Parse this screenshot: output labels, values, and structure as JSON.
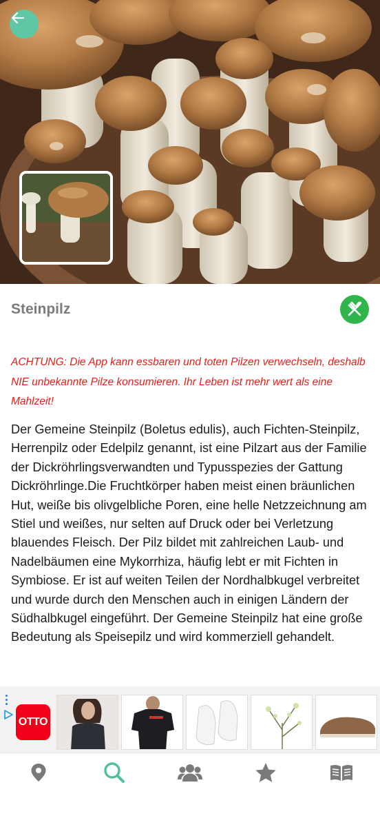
{
  "app": {
    "title": "Steinpilz"
  },
  "header": {
    "back_icon": "arrow-left-icon",
    "back_color": "#5fc7a3"
  },
  "mushroom": {
    "name": "Steinpilz",
    "edibility_icon": "fork-knife-icon",
    "edibility_color": "#2fb54a"
  },
  "warning": {
    "text": "ACHTUNG: Die App kann essbaren und toten Pilzen verwechseln, deshalb NIE unbekannte Pilze konsumieren. Ihr Leben ist mehr wert als eine Mahlzeit!",
    "color": "#e3211b"
  },
  "description": "Der Gemeine Steinpilz (Boletus edulis), auch Fichten-Steinpilz, Herrenpilz oder Edelpilz genannt, ist eine Pilzart aus der Familie der Dickröhrlingsverwandten und Typusspezies der Gattung Dickröhrlinge.Die Fruchtkörper haben meist einen bräunlichen Hut, weiße bis olivgelbliche Poren, eine helle Netzzeichnung am Stiel und weißes, nur selten auf Druck oder bei Verletzung blauendes Fleisch. Der Pilz bildet mit zahlreichen Laub- und Nadelbäumen eine Mykorrhiza, häufig lebt er mit Fichten in Symbiose. Er ist auf weiten Teilen der Nordhalbkugel verbreitet und wurde durch den Menschen auch in einigen Ländern der Südhalbkugel eingeführt. Der Gemeine Steinpilz hat eine große Bedeutung als Speisepilz und wird kommerziell gehandelt.",
  "ad": {
    "brand": "OTTO",
    "brand_color": "#f20019",
    "products": [
      "woman-top-image",
      "polo-shirt-image",
      "white-sneakers-image",
      "plant-branch-image",
      "loafer-shoe-image"
    ]
  },
  "bottom_nav": {
    "items": [
      {
        "icon": "map-pin-icon",
        "active": false
      },
      {
        "icon": "search-icon",
        "active": true
      },
      {
        "icon": "users-icon",
        "active": false
      },
      {
        "icon": "star-icon",
        "active": false
      },
      {
        "icon": "book-icon",
        "active": false
      }
    ],
    "active_color": "#4fbfa0",
    "inactive_color": "#7a7a7a"
  }
}
